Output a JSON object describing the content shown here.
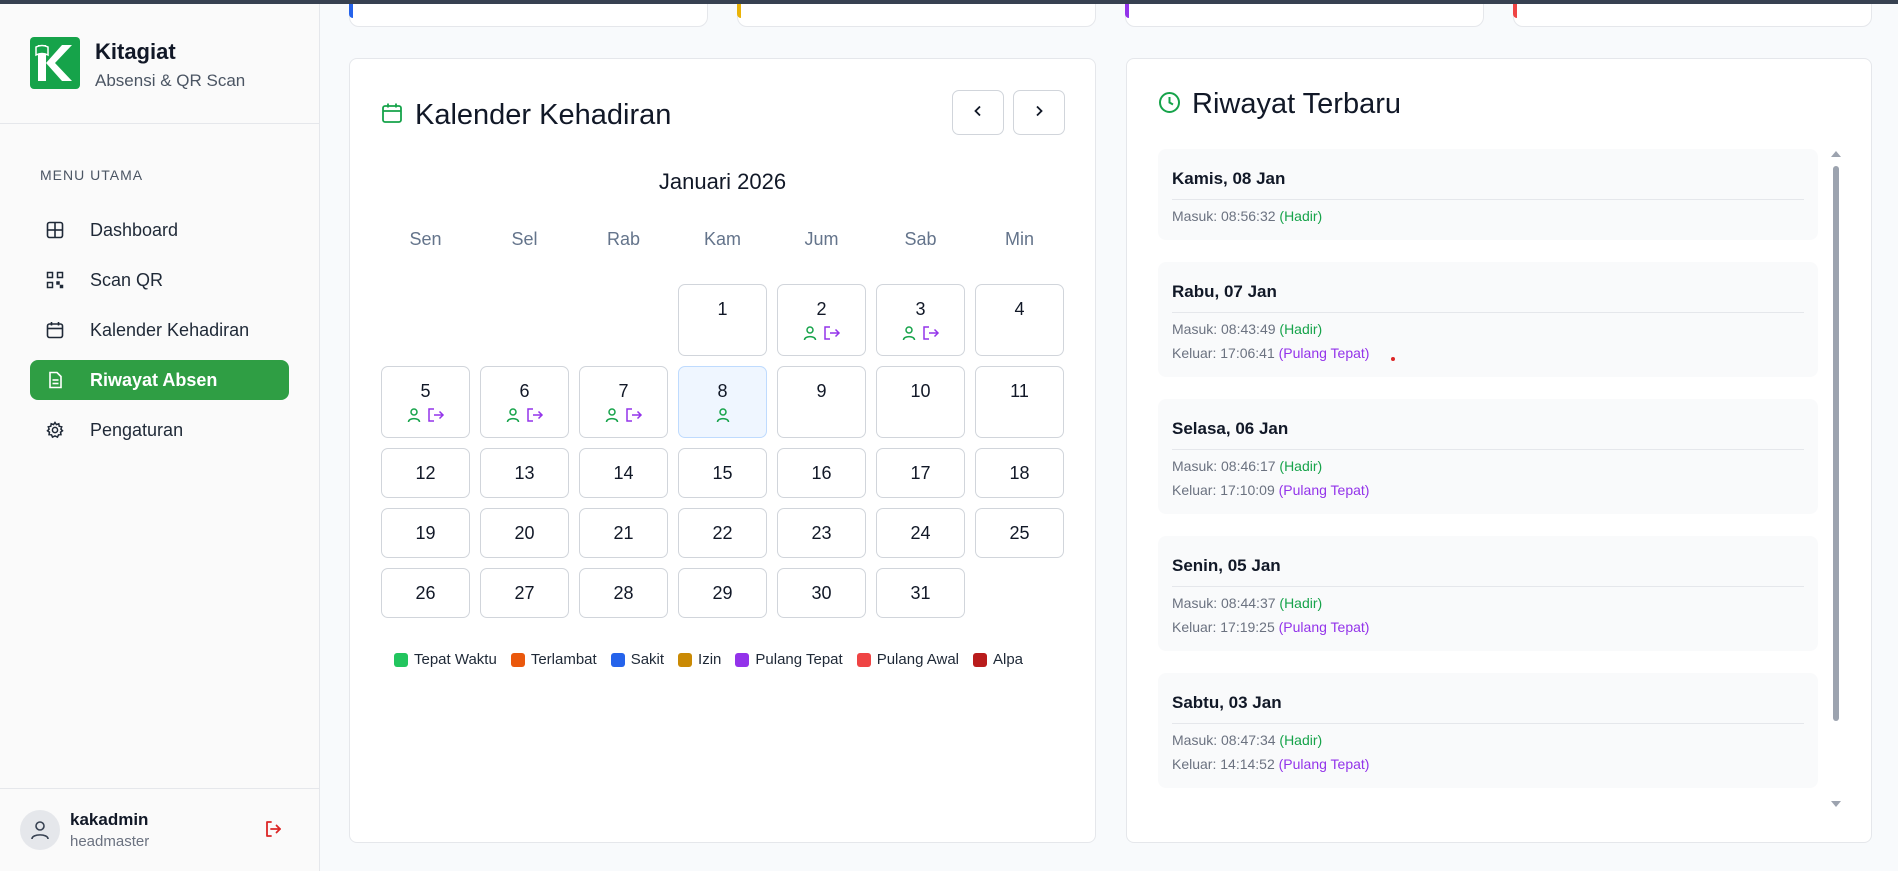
{
  "brand": {
    "name": "Kitagiat",
    "subtitle": "Absensi & QR Scan"
  },
  "menu": {
    "heading": "MENU UTAMA",
    "items": [
      {
        "label": "Dashboard",
        "icon": "grid-icon"
      },
      {
        "label": "Scan QR",
        "icon": "qr-icon"
      },
      {
        "label": "Kalender Kehadiran",
        "icon": "calendar-icon"
      },
      {
        "label": "Riwayat Absen",
        "icon": "document-icon",
        "active": true
      },
      {
        "label": "Pengaturan",
        "icon": "gear-icon"
      }
    ]
  },
  "user": {
    "name": "kakadmin",
    "role": "headmaster"
  },
  "calendar": {
    "title": "Kalender Kehadiran",
    "month": "Januari 2026",
    "weekdays": [
      "Sen",
      "Sel",
      "Rab",
      "Kam",
      "Jum",
      "Sab",
      "Min"
    ],
    "dates": [
      "1",
      "2",
      "3",
      "4",
      "5",
      "6",
      "7",
      "8",
      "9",
      "10",
      "11",
      "12",
      "13",
      "14",
      "15",
      "16",
      "17",
      "18",
      "19",
      "20",
      "21",
      "22",
      "23",
      "24",
      "25",
      "26",
      "27",
      "28",
      "29",
      "30",
      "31"
    ],
    "today": "8",
    "legend": [
      {
        "label": "Tepat Waktu",
        "color": "#22c55e"
      },
      {
        "label": "Terlambat",
        "color": "#ea580c"
      },
      {
        "label": "Sakit",
        "color": "#2563eb"
      },
      {
        "label": "Izin",
        "color": "#ca8a04"
      },
      {
        "label": "Pulang Tepat",
        "color": "#9333ea"
      },
      {
        "label": "Pulang Awal",
        "color": "#ef4444"
      },
      {
        "label": "Alpa",
        "color": "#b91c1c"
      }
    ]
  },
  "history": {
    "title": "Riwayat Terbaru",
    "entries": [
      {
        "date": "Kamis, 08 Jan",
        "in_label": "Masuk: 08:56:32",
        "in_status": "(Hadir)"
      },
      {
        "date": "Rabu, 07 Jan",
        "in_label": "Masuk: 08:43:49",
        "in_status": "(Hadir)",
        "out_label": "Keluar: 17:06:41",
        "out_status": "(Pulang Tepat)"
      },
      {
        "date": "Selasa, 06 Jan",
        "in_label": "Masuk: 08:46:17",
        "in_status": "(Hadir)",
        "out_label": "Keluar: 17:10:09",
        "out_status": "(Pulang Tepat)"
      },
      {
        "date": "Senin, 05 Jan",
        "in_label": "Masuk: 08:44:37",
        "in_status": "(Hadir)",
        "out_label": "Keluar: 17:19:25",
        "out_status": "(Pulang Tepat)"
      },
      {
        "date": "Sabtu, 03 Jan",
        "in_label": "Masuk: 08:47:34",
        "in_status": "(Hadir)",
        "out_label": "Keluar: 14:14:52",
        "out_status": "(Pulang Tepat)"
      }
    ]
  },
  "colors": {
    "accent": "#2f9e44",
    "hadir": "#16a34a",
    "pulang": "#9333ea",
    "logout": "#dc2626"
  }
}
